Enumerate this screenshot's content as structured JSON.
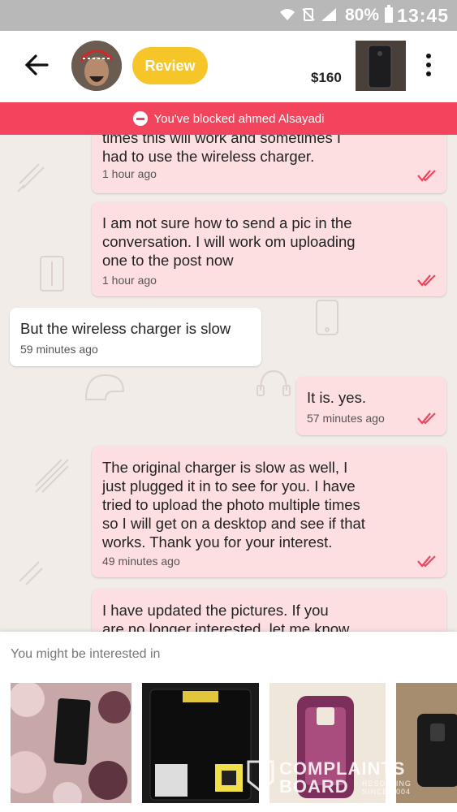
{
  "status_bar": {
    "battery": "80%",
    "time": "13:45"
  },
  "header": {
    "review_label": "Review",
    "price": "$160"
  },
  "banner": {
    "text": "You've blocked ahmed Alsayadi"
  },
  "messages": [
    {
      "direction": "out",
      "text": "times this will work and sometimes I\nhad to use the wireless charger.",
      "time": "1 hour ago",
      "read": true
    },
    {
      "direction": "out",
      "text": "I am not sure how to send a pic in the\nconversation. I will work om uploading\none to the post now",
      "time": "1 hour ago",
      "read": true
    },
    {
      "direction": "in",
      "text": "But the wireless charger is slow",
      "time": "59 minutes ago"
    },
    {
      "direction": "out",
      "text": "It is. yes.",
      "time": "57 minutes ago",
      "read": true
    },
    {
      "direction": "out",
      "text": "The original charger is slow as well, I\njust plugged it in to see for you. I have\ntried to upload the photo multiple times\nso I will get on a desktop and see if that\nworks. Thank you for your interest.",
      "time": "49 minutes ago",
      "read": true
    },
    {
      "direction": "out",
      "text": "I have updated the pictures. If you\nare no longer interested, let me know",
      "time": ""
    }
  ],
  "recommendations": {
    "title": "You might be interested in",
    "items": [
      {
        "icon": "lg-phone-on-floral-fabric"
      },
      {
        "icon": "boxed-phone-in-case"
      },
      {
        "icon": "phone-in-purple-case"
      },
      {
        "icon": "black-phone-case"
      }
    ]
  },
  "watermark": {
    "line1": "COMPLAINTS",
    "line2": "BOARD",
    "small1": "RESOLVING",
    "small2": "SINCE 2004"
  },
  "colors": {
    "banner": "#f2445c",
    "review": "#f6c528",
    "outgoing_bubble": "#fddfe2",
    "tick": "#f2445c"
  }
}
